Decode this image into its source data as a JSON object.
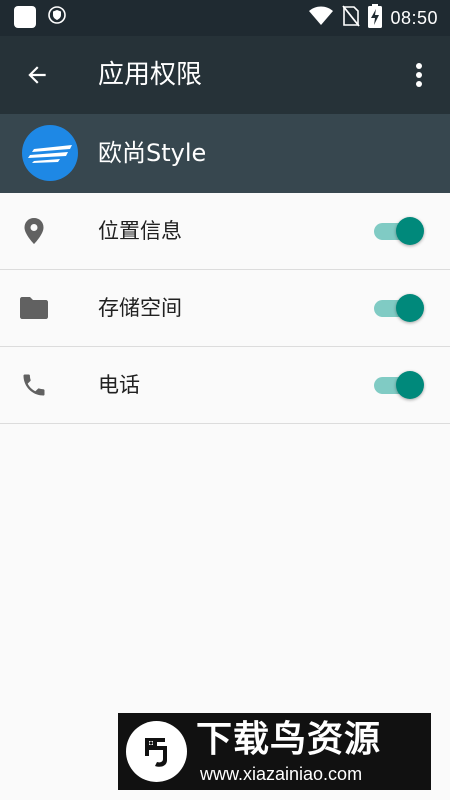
{
  "status_bar": {
    "time": "08:50",
    "icons": [
      "notification-square-icon",
      "shield-icon",
      "wifi-icon",
      "no-sim-icon",
      "battery-charging-icon"
    ]
  },
  "app_bar": {
    "title": "应用权限",
    "back_icon": "arrow-back-icon",
    "menu_icon": "more-vert-icon"
  },
  "app": {
    "name": "欧尚Style",
    "icon_color": "#1e88e5"
  },
  "permissions": [
    {
      "label": "位置信息",
      "icon": "location-pin-icon",
      "enabled": true
    },
    {
      "label": "存储空间",
      "icon": "folder-icon",
      "enabled": true
    },
    {
      "label": "电话",
      "icon": "phone-icon",
      "enabled": true
    }
  ],
  "watermark": {
    "title": "下载鸟资源",
    "url": "www.xiazainiao.com"
  },
  "colors": {
    "status_bar": "#1f2a31",
    "app_bar": "#263238",
    "app_header": "#37474f",
    "accent": "#00897b",
    "accent_track": "#80cbc4"
  }
}
